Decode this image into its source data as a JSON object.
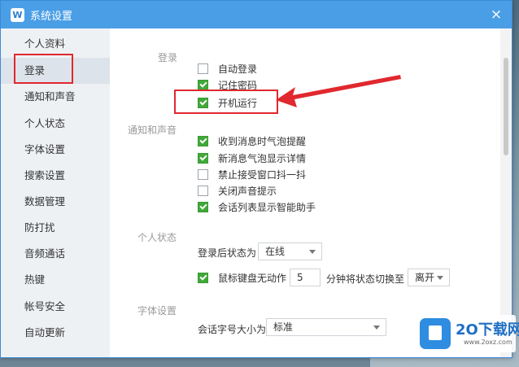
{
  "window": {
    "title": "系统设置",
    "logo_glyph": "W",
    "close_glyph": "×"
  },
  "sidebar": {
    "items": [
      {
        "label": "个人资料"
      },
      {
        "label": "登录"
      },
      {
        "label": "通知和声音"
      },
      {
        "label": "个人状态"
      },
      {
        "label": "字体设置"
      },
      {
        "label": "搜索设置"
      },
      {
        "label": "数据管理"
      },
      {
        "label": "防打扰"
      },
      {
        "label": "音频通话"
      },
      {
        "label": "热键"
      },
      {
        "label": "帐号安全"
      },
      {
        "label": "自动更新"
      }
    ],
    "active_index": 1
  },
  "login": {
    "section_title": "登录",
    "options": [
      {
        "label": "自动登录",
        "checked": false
      },
      {
        "label": "记住密码",
        "checked": true
      },
      {
        "label": "开机运行",
        "checked": true
      }
    ]
  },
  "notify": {
    "section_title": "通知和声音",
    "options": [
      {
        "label": "收到消息时气泡提醒",
        "checked": true
      },
      {
        "label": "新消息气泡显示详情",
        "checked": true
      },
      {
        "label": "禁止接受窗口抖一抖",
        "checked": false
      },
      {
        "label": "关闭声音提示",
        "checked": false
      },
      {
        "label": "会话列表显示智能助手",
        "checked": true
      }
    ]
  },
  "status": {
    "section_title": "个人状态",
    "after_login_label": "登录后状态为",
    "after_login_value": "在线",
    "idle_checkbox_label": "鼠标键盘无动作",
    "idle_checked": true,
    "idle_minutes": "5",
    "idle_suffix": "分钟将状态切换至",
    "idle_status_value": "离开"
  },
  "font": {
    "section_title": "字体设置",
    "size_label": "会话字号大小为",
    "size_value": "标准"
  },
  "watermark": {
    "brand": "2O下载网",
    "url": "www.2oxz.com"
  },
  "colors": {
    "titlebar": "#4a9ee6",
    "checkbox_on": "#41a83a",
    "annotation": "#e0282e"
  }
}
